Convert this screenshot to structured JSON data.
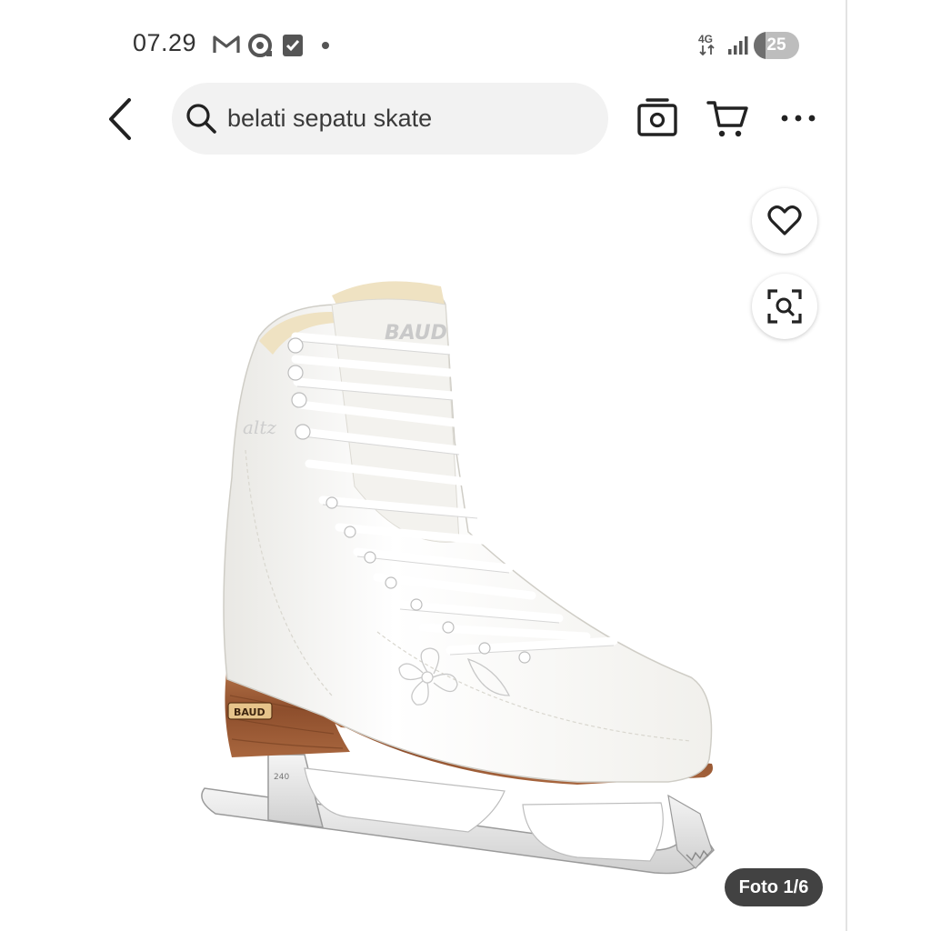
{
  "status_bar": {
    "time": "07.29",
    "network": "4G",
    "battery": 25,
    "battery_label": "25",
    "notification_icons": [
      "gmail-icon",
      "lens-app-icon",
      "checkbox-app-icon",
      "more-dot-icon"
    ]
  },
  "top_bar": {
    "search_query": "belati sepatu skate",
    "icons": [
      "back-arrow-icon",
      "search-icon",
      "camera-icon",
      "cart-icon",
      "more-icon"
    ]
  },
  "floating_actions": {
    "icons": [
      "heart-icon",
      "image-search-icon"
    ]
  },
  "product": {
    "image_subject": "white figure ice skate",
    "brand_marking": "BAUD",
    "photo_counter": "Foto 1/6"
  },
  "colors": {
    "search_bg": "#f2f2f2",
    "counter_bg": "#282828",
    "skate_heel_wood": "#9b5a36"
  }
}
